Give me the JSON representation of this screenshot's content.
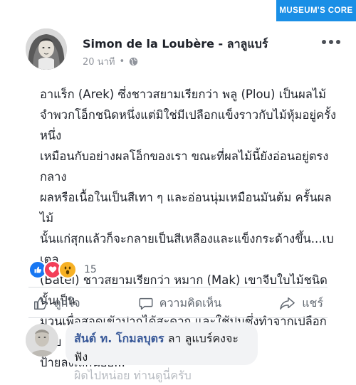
{
  "badge": {
    "label": "MUSEUM'S CORE"
  },
  "post": {
    "author": "Simon de la Loubère - ลาลูแบร์",
    "time": "20 นาที",
    "text_lines": [
      "อาแร็ก (Arek) ซึ่งชาวสยามเรียกว่า พลู (Plou) เป็นผลไม้",
      "จำพวกโอ็กชนิดหนึ่งแต่มิใช่มีเปลือกแข็งราวกับไม้หุ้มอยู่ครั้งหนึ่ง",
      "เหมือนกับอย่างผลโอ็กของเรา ขณะที่ผลไม้นี้ยังอ่อนอยู่ตรงกลาง",
      "ผลหรือเนื้อในเป็นสีเทา ๆ และอ่อนนุ่มเหมือนมันต้ม ครั้นผลไม้",
      "นั้นแก่สุกแล้วก็จะกลายเป็นสีเหลืองและแข็งกระด้างขึ้น...เบเตล",
      "(Batel) ชาวสยามเรียกว่า หมาก (Mak) เขาจีบใบไม้ชนิดนั้นเป็น",
      "มวนเพื่อสอดเข้าปากได้สะดวก และใช้ปูนซึ่งทำจากเปลือกหอย",
      "ป้ายลงเล็กน้อย..."
    ]
  },
  "reactions": {
    "count": "15",
    "icons": [
      "like-icon",
      "love-icon",
      "wow-icon"
    ],
    "colors": {
      "like": "#1877f2",
      "love": "#f33e58",
      "wow": "#f7b125"
    }
  },
  "actions": {
    "like": "ถูกใจ",
    "comment": "ความคิดเห็น",
    "share": "แชร์"
  },
  "comment": {
    "author": "สันต์ ท. โกมลบุตร",
    "text": "ลา ลูแบร์คงจะฟัง",
    "faded": "ผิดไปหน่อย ท่านดูนี่ครับ"
  }
}
